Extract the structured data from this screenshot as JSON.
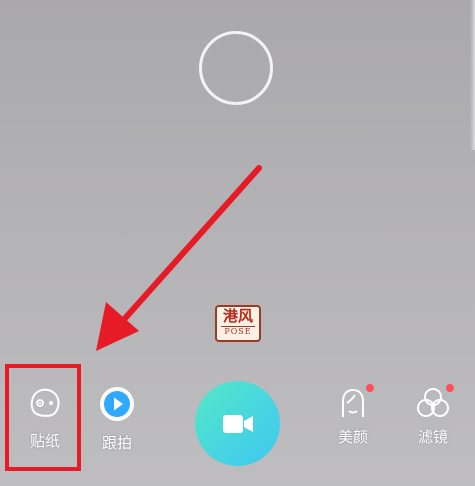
{
  "badge": {
    "main_text": "港风",
    "sub_text": "POSE"
  },
  "toolbar": {
    "sticker_label": "贴纸",
    "follow_label": "跟拍",
    "beauty_label": "美颜",
    "filter_label": "滤镜"
  },
  "icons": {
    "focus": "focus-ring-icon",
    "sticker": "sticker-face-icon",
    "follow": "play-icon",
    "record": "video-camera-icon",
    "beauty": "face-outline-icon",
    "filter": "three-circles-icon"
  },
  "colors": {
    "annotation_red": "#e71b26",
    "record_gradient_start": "#52e8c6",
    "record_gradient_end": "#3fc7f0",
    "follow_blue": "#2fa8ff",
    "notification_dot": "#ff4f5a"
  }
}
